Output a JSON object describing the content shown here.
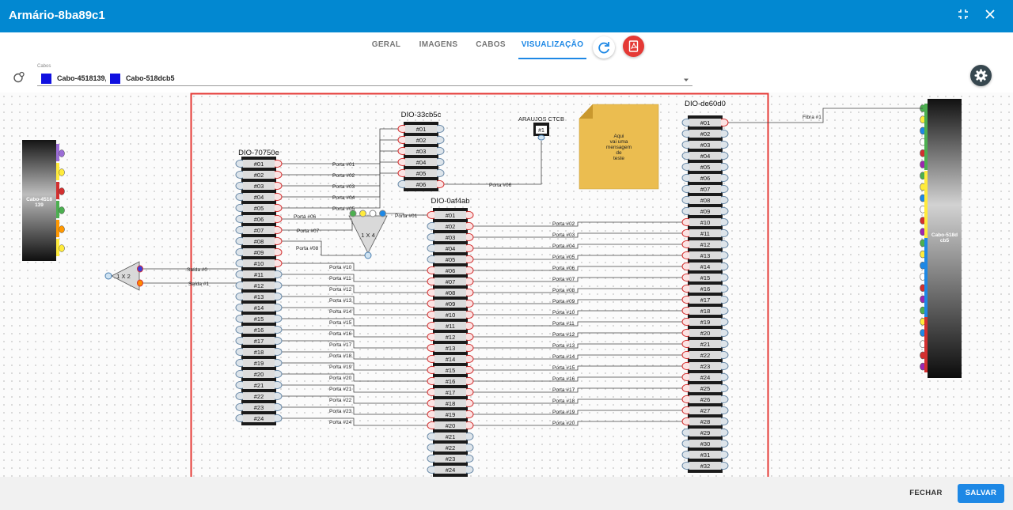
{
  "window": {
    "title": "Armário-8ba89c1"
  },
  "tabs": [
    {
      "label": "GERAL"
    },
    {
      "label": "IMAGENS"
    },
    {
      "label": "CABOS"
    },
    {
      "label": "VISUALIZAÇÃO",
      "active": true
    }
  ],
  "cabos": {
    "label": "Cabos",
    "selected": [
      "Cabo-4518139,",
      "Cabo-518dcb5"
    ],
    "swatch_color": "#1010e0"
  },
  "footer": {
    "close_label": "FECHAR",
    "save_label": "SALVAR"
  },
  "colors": {
    "accent": "#0288d1",
    "selection_border": "#e53935",
    "pdf_button": "#e53935",
    "note": "#ebbd50"
  },
  "diagram": {
    "cables": [
      {
        "name": "Cabo-4518139",
        "label_lines": [
          "Cabo-4518",
          "139"
        ],
        "fibers": [
          "#9b6dd6",
          "#ffeb3b",
          "#d32f2f",
          "#4caf50",
          "#ff9800",
          "#ffeb3b"
        ]
      },
      {
        "name": "Cabo-518dcb5",
        "label_lines": [
          "Cabo-518d",
          "cb5"
        ],
        "fibers": [
          "#4caf50",
          "#ffeb3b",
          "#1e88e5",
          "#ffffff",
          "#d32f2f",
          "#9c27b0",
          "#4caf50",
          "#ffeb3b",
          "#1e88e5",
          "#ffffff",
          "#d32f2f",
          "#9c27b0",
          "#4caf50",
          "#ffeb3b",
          "#1e88e5",
          "#ffffff",
          "#d32f2f",
          "#9c27b0",
          "#4caf50",
          "#ffeb3b",
          "#1e88e5",
          "#ffffff",
          "#d32f2f",
          "#9c27b0"
        ]
      }
    ],
    "dios": [
      {
        "name": "DIO-70750e",
        "ports": 24
      },
      {
        "name": "DIO-33cb5c",
        "ports": 6
      },
      {
        "name": "DIO-0af4ab",
        "ports": 24
      },
      {
        "name": "DIO-de60d0",
        "ports": 32
      }
    ],
    "splitters": [
      {
        "label": "1 X 2",
        "outputs": [
          "Saída #0",
          "Saída #1"
        ]
      },
      {
        "label": "1 X 4"
      }
    ],
    "terminal": {
      "name": "ARAUJOS CTCB",
      "port": "#1"
    },
    "note_text": [
      "Aqui",
      "vai uma",
      "mensagem",
      "de",
      "teste"
    ],
    "fibra_label": "Fibra #1",
    "labels": {
      "dio70_to_33": [
        "Porta #01",
        "Porta #02",
        "Porta #03",
        "Porta #04",
        "Porta #05"
      ],
      "dio70_to_split": [
        "Porta #06",
        "Porta #07",
        "Porta #08"
      ],
      "split_out": "Porta #01",
      "dio33_to_term": "Porta #06",
      "dio70_to_0af": [
        "Porta #10",
        "Porta #11",
        "Porta #12",
        "Porta #13",
        "Porta #14",
        "Porta #15",
        "Porta #16",
        "Porta #17",
        "Porta #18",
        "Porta #19",
        "Porta #20",
        "Porta #21",
        "Porta #22",
        "Porta #23",
        "Porta #24"
      ],
      "dio0af_to_de6": [
        "Porta #02",
        "Porta #03",
        "Porta #04",
        "Porta #05",
        "Porta #06",
        "Porta #07",
        "Porta #08",
        "Porta #09",
        "Porta #10",
        "Porta #11",
        "Porta #12",
        "Porta #13",
        "Porta #14",
        "Porta #15",
        "Porta #16",
        "Porta #17",
        "Porta #18",
        "Porta #19",
        "Porta #20"
      ]
    }
  }
}
